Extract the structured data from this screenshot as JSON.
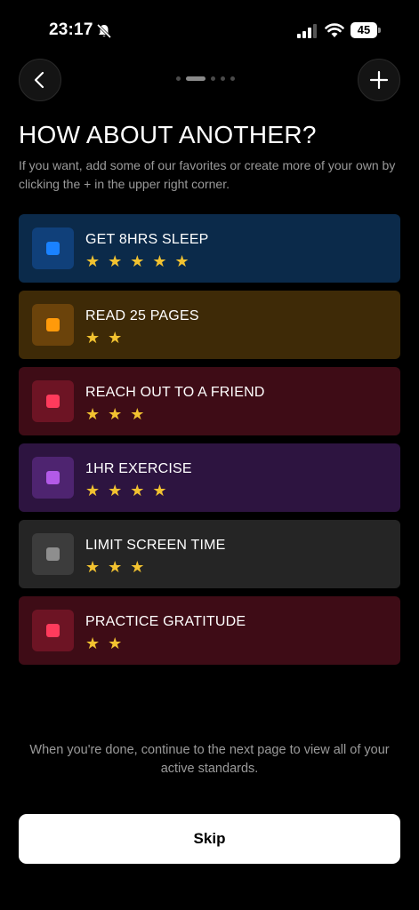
{
  "status_bar": {
    "time": "23:17",
    "battery": "45"
  },
  "nav": {
    "back_icon": "chevron-left-icon",
    "add_icon": "plus-icon",
    "pager": {
      "count": 5,
      "active_index": 1
    }
  },
  "header": {
    "title": "HOW ABOUT ANOTHER?",
    "subtitle": "If you want, add some of our favorites or create more of your own by clicking the + in the upper right corner."
  },
  "cards": [
    {
      "label": "GET 8HRS SLEEP",
      "stars": "★ ★ ★ ★ ★",
      "rating": 5,
      "bg": "#0b2a4a",
      "badge_bg": "#10407a",
      "swatch": "#1a82ff"
    },
    {
      "label": "READ 25 PAGES",
      "stars": "★ ★",
      "rating": 2,
      "bg": "#3e2a07",
      "badge_bg": "#6b430b",
      "swatch": "#ff9a0a"
    },
    {
      "label": "REACH OUT TO A FRIEND",
      "stars": "★ ★ ★",
      "rating": 3,
      "bg": "#3e0c16",
      "badge_bg": "#6d1424",
      "swatch": "#ff3b5c"
    },
    {
      "label": "1HR EXERCISE",
      "stars": "★ ★ ★ ★",
      "rating": 4,
      "bg": "#2d1440",
      "badge_bg": "#4e2470",
      "swatch": "#b35ae8"
    },
    {
      "label": "LIMIT SCREEN TIME",
      "stars": "★ ★ ★",
      "rating": 3,
      "bg": "#252525",
      "badge_bg": "#3c3c3c",
      "swatch": "#8e8e8e"
    },
    {
      "label": "PRACTICE GRATITUDE",
      "stars": "★ ★",
      "rating": 2,
      "bg": "#3e0c16",
      "badge_bg": "#6d1424",
      "swatch": "#ff3b5c"
    }
  ],
  "footer": {
    "note": "When you're done, continue to the next page to view all of your active standards.",
    "skip_label": "Skip"
  }
}
